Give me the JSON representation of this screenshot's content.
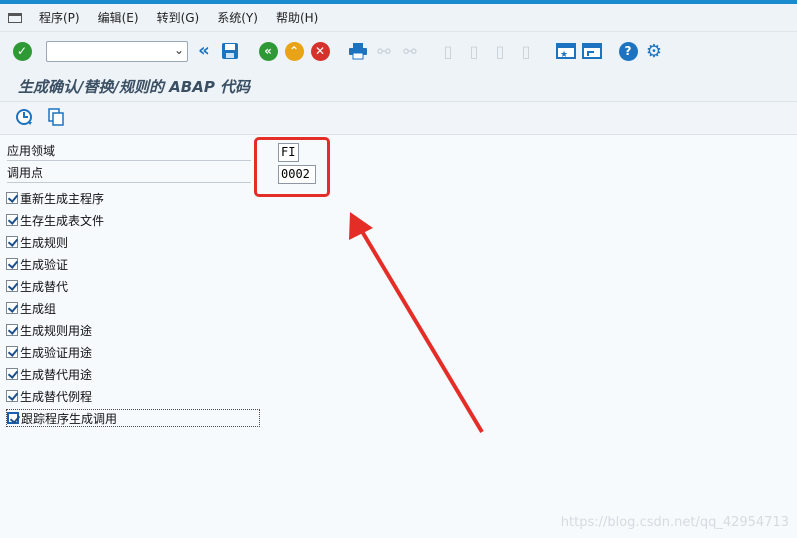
{
  "menu": {
    "items": [
      "程序(P)",
      "编辑(E)",
      "转到(G)",
      "系统(Y)",
      "帮助(H)"
    ]
  },
  "window": {
    "title": "生成确认/替换/规则的 ABAP 代码"
  },
  "fields": [
    {
      "label": "应用领域",
      "value": "FI"
    },
    {
      "label": "调用点",
      "value": "0002"
    }
  ],
  "options": [
    {
      "label": "重新生成主程序",
      "checked": true
    },
    {
      "label": "生存生成表文件",
      "checked": true
    },
    {
      "label": "生成规则",
      "checked": true
    },
    {
      "label": "生成验证",
      "checked": true
    },
    {
      "label": "生成替代",
      "checked": true
    },
    {
      "label": "生成组",
      "checked": true
    },
    {
      "label": "生成规则用途",
      "checked": true
    },
    {
      "label": "生成验证用途",
      "checked": true
    },
    {
      "label": "生成替代用途",
      "checked": true
    },
    {
      "label": "生成替代例程",
      "checked": true
    },
    {
      "label": "跟踪程序生成调用",
      "checked": true
    }
  ],
  "colors": {
    "accent": "#1a8ccd",
    "annotation": "#e52d27"
  },
  "watermark": "https://blog.csdn.net/qq_42954713"
}
